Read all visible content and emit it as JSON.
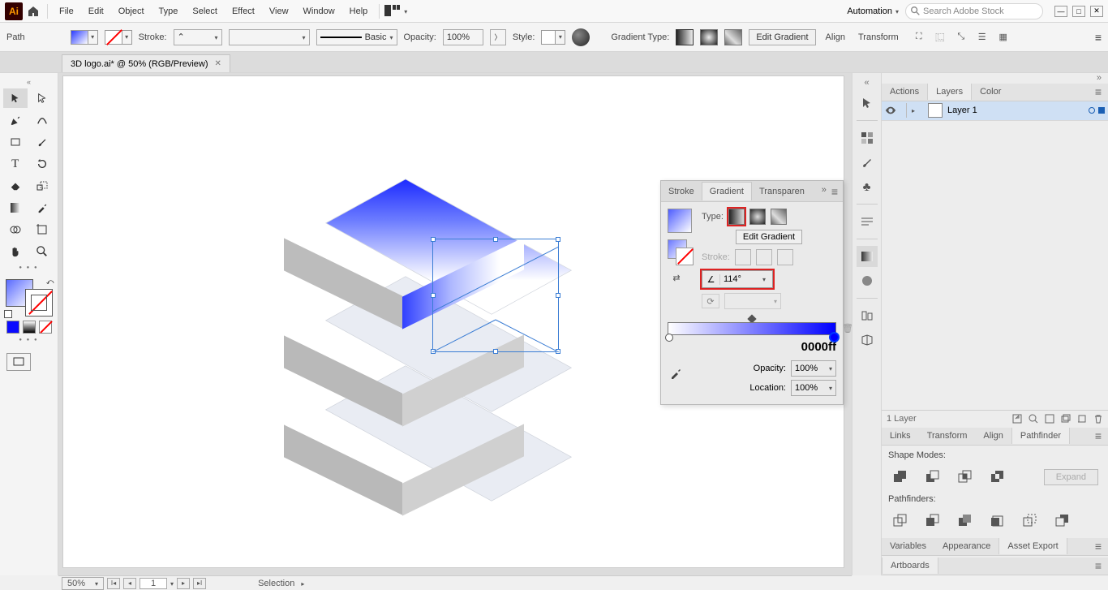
{
  "menubar": {
    "logo": "Ai",
    "items": [
      "File",
      "Edit",
      "Object",
      "Type",
      "Select",
      "Effect",
      "View",
      "Window",
      "Help"
    ],
    "workspace": "Automation",
    "search_placeholder": "Search Adobe Stock"
  },
  "controlbar": {
    "object_label": "Path",
    "stroke_label": "Stroke:",
    "brush_label": "Basic",
    "opacity_label": "Opacity:",
    "opacity_value": "100%",
    "style_label": "Style:",
    "gradtype_label": "Gradient Type:",
    "edit_gradient_btn": "Edit Gradient",
    "align_label": "Align",
    "transform_label": "Transform"
  },
  "tab": {
    "title": "3D logo.ai* @ 50% (RGB/Preview)"
  },
  "gradient_panel": {
    "tabs": [
      "Stroke",
      "Gradient",
      "Transparen"
    ],
    "active_tab": 1,
    "type_label": "Type:",
    "edit_btn": "Edit Gradient",
    "stroke_label": "Stroke:",
    "angle_value": "114°",
    "hex": "0000ff",
    "opacity_label": "Opacity:",
    "opacity_value": "100%",
    "location_label": "Location:",
    "location_value": "100%"
  },
  "right_panels": {
    "group1": {
      "tabs": [
        "Actions",
        "Layers",
        "Color"
      ],
      "active": 1
    },
    "layer_name": "Layer 1",
    "layer_count": "1 Layer",
    "group2": {
      "tabs": [
        "Links",
        "Transform",
        "Align",
        "Pathfinder"
      ],
      "active": 3
    },
    "shape_modes_label": "Shape Modes:",
    "expand_label": "Expand",
    "pathfinders_label": "Pathfinders:",
    "group3": {
      "tabs": [
        "Variables",
        "Appearance",
        "Asset Export"
      ],
      "active": 2
    },
    "group4": {
      "tabs": [
        "Artboards"
      ],
      "active": 0
    }
  },
  "statusbar": {
    "zoom": "50%",
    "artboard_num": "1",
    "selection": "Selection"
  }
}
